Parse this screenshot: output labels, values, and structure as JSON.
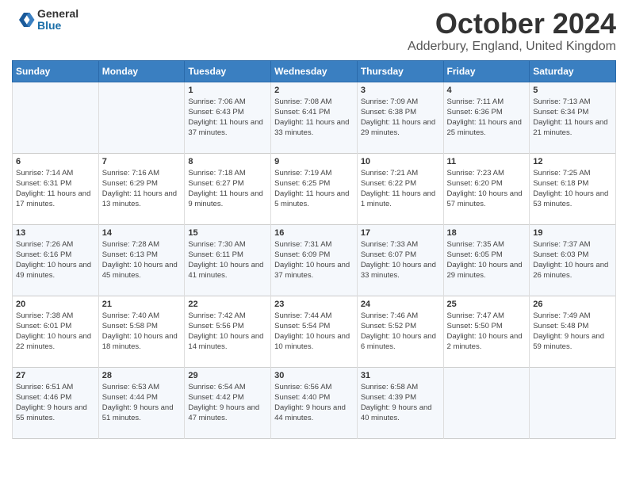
{
  "header": {
    "logo_general": "General",
    "logo_blue": "Blue",
    "month_title": "October 2024",
    "location": "Adderbury, England, United Kingdom"
  },
  "days_of_week": [
    "Sunday",
    "Monday",
    "Tuesday",
    "Wednesday",
    "Thursday",
    "Friday",
    "Saturday"
  ],
  "weeks": [
    [
      {
        "day": "",
        "info": ""
      },
      {
        "day": "",
        "info": ""
      },
      {
        "day": "1",
        "info": "Sunrise: 7:06 AM\nSunset: 6:43 PM\nDaylight: 11 hours and 37 minutes."
      },
      {
        "day": "2",
        "info": "Sunrise: 7:08 AM\nSunset: 6:41 PM\nDaylight: 11 hours and 33 minutes."
      },
      {
        "day": "3",
        "info": "Sunrise: 7:09 AM\nSunset: 6:38 PM\nDaylight: 11 hours and 29 minutes."
      },
      {
        "day": "4",
        "info": "Sunrise: 7:11 AM\nSunset: 6:36 PM\nDaylight: 11 hours and 25 minutes."
      },
      {
        "day": "5",
        "info": "Sunrise: 7:13 AM\nSunset: 6:34 PM\nDaylight: 11 hours and 21 minutes."
      }
    ],
    [
      {
        "day": "6",
        "info": "Sunrise: 7:14 AM\nSunset: 6:31 PM\nDaylight: 11 hours and 17 minutes."
      },
      {
        "day": "7",
        "info": "Sunrise: 7:16 AM\nSunset: 6:29 PM\nDaylight: 11 hours and 13 minutes."
      },
      {
        "day": "8",
        "info": "Sunrise: 7:18 AM\nSunset: 6:27 PM\nDaylight: 11 hours and 9 minutes."
      },
      {
        "day": "9",
        "info": "Sunrise: 7:19 AM\nSunset: 6:25 PM\nDaylight: 11 hours and 5 minutes."
      },
      {
        "day": "10",
        "info": "Sunrise: 7:21 AM\nSunset: 6:22 PM\nDaylight: 11 hours and 1 minute."
      },
      {
        "day": "11",
        "info": "Sunrise: 7:23 AM\nSunset: 6:20 PM\nDaylight: 10 hours and 57 minutes."
      },
      {
        "day": "12",
        "info": "Sunrise: 7:25 AM\nSunset: 6:18 PM\nDaylight: 10 hours and 53 minutes."
      }
    ],
    [
      {
        "day": "13",
        "info": "Sunrise: 7:26 AM\nSunset: 6:16 PM\nDaylight: 10 hours and 49 minutes."
      },
      {
        "day": "14",
        "info": "Sunrise: 7:28 AM\nSunset: 6:13 PM\nDaylight: 10 hours and 45 minutes."
      },
      {
        "day": "15",
        "info": "Sunrise: 7:30 AM\nSunset: 6:11 PM\nDaylight: 10 hours and 41 minutes."
      },
      {
        "day": "16",
        "info": "Sunrise: 7:31 AM\nSunset: 6:09 PM\nDaylight: 10 hours and 37 minutes."
      },
      {
        "day": "17",
        "info": "Sunrise: 7:33 AM\nSunset: 6:07 PM\nDaylight: 10 hours and 33 minutes."
      },
      {
        "day": "18",
        "info": "Sunrise: 7:35 AM\nSunset: 6:05 PM\nDaylight: 10 hours and 29 minutes."
      },
      {
        "day": "19",
        "info": "Sunrise: 7:37 AM\nSunset: 6:03 PM\nDaylight: 10 hours and 26 minutes."
      }
    ],
    [
      {
        "day": "20",
        "info": "Sunrise: 7:38 AM\nSunset: 6:01 PM\nDaylight: 10 hours and 22 minutes."
      },
      {
        "day": "21",
        "info": "Sunrise: 7:40 AM\nSunset: 5:58 PM\nDaylight: 10 hours and 18 minutes."
      },
      {
        "day": "22",
        "info": "Sunrise: 7:42 AM\nSunset: 5:56 PM\nDaylight: 10 hours and 14 minutes."
      },
      {
        "day": "23",
        "info": "Sunrise: 7:44 AM\nSunset: 5:54 PM\nDaylight: 10 hours and 10 minutes."
      },
      {
        "day": "24",
        "info": "Sunrise: 7:46 AM\nSunset: 5:52 PM\nDaylight: 10 hours and 6 minutes."
      },
      {
        "day": "25",
        "info": "Sunrise: 7:47 AM\nSunset: 5:50 PM\nDaylight: 10 hours and 2 minutes."
      },
      {
        "day": "26",
        "info": "Sunrise: 7:49 AM\nSunset: 5:48 PM\nDaylight: 9 hours and 59 minutes."
      }
    ],
    [
      {
        "day": "27",
        "info": "Sunrise: 6:51 AM\nSunset: 4:46 PM\nDaylight: 9 hours and 55 minutes."
      },
      {
        "day": "28",
        "info": "Sunrise: 6:53 AM\nSunset: 4:44 PM\nDaylight: 9 hours and 51 minutes."
      },
      {
        "day": "29",
        "info": "Sunrise: 6:54 AM\nSunset: 4:42 PM\nDaylight: 9 hours and 47 minutes."
      },
      {
        "day": "30",
        "info": "Sunrise: 6:56 AM\nSunset: 4:40 PM\nDaylight: 9 hours and 44 minutes."
      },
      {
        "day": "31",
        "info": "Sunrise: 6:58 AM\nSunset: 4:39 PM\nDaylight: 9 hours and 40 minutes."
      },
      {
        "day": "",
        "info": ""
      },
      {
        "day": "",
        "info": ""
      }
    ]
  ]
}
